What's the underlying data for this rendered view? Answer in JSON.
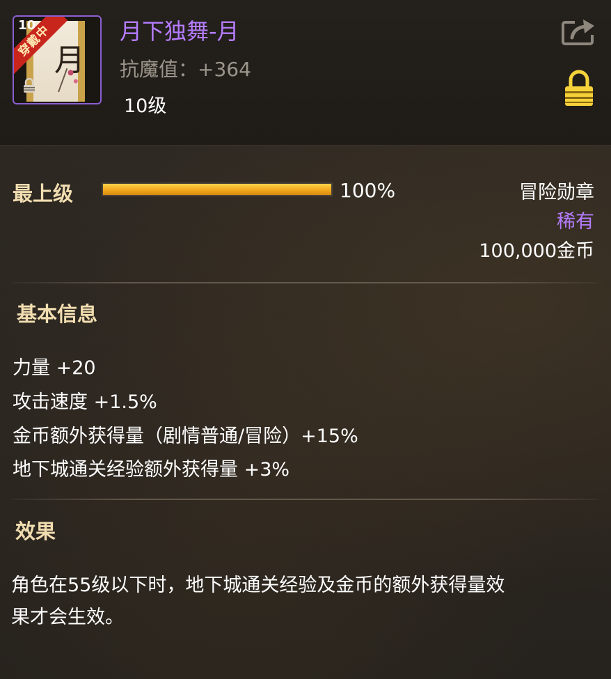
{
  "item": {
    "name": "月下独舞-月",
    "stat_line": "抗魔值：+364",
    "level": "10级",
    "icon_corner_level": "10",
    "equipped_ribbon": "穿戴中",
    "card_glyph": "月"
  },
  "header_actions": {
    "share_icon": "share-export-icon",
    "lock_icon": "padlock-icon"
  },
  "mastery": {
    "label": "最上级",
    "progress": 1.0,
    "progress_text": "100%"
  },
  "badge": {
    "type": "冒险勋章",
    "rarity": "稀有",
    "price": "100,000金币"
  },
  "basic_info": {
    "title": "基本信息",
    "stats": [
      "力量 +20",
      "攻击速度 +1.5%",
      "金币额外获得量（剧情普通/冒险）+15%",
      "地下城通关经验额外获得量 +3%"
    ]
  },
  "effect": {
    "title": "效果",
    "text_line1": "角色在55级以下时，地下城通关经验及金币的额外获得量效",
    "text_line2": "果才会生效。"
  },
  "colors": {
    "rarity_purple": "#b57cff",
    "section_gold": "#f1ddb0",
    "progress_orange": "#f0a81c",
    "lock_yellow": "#f5d23a"
  }
}
